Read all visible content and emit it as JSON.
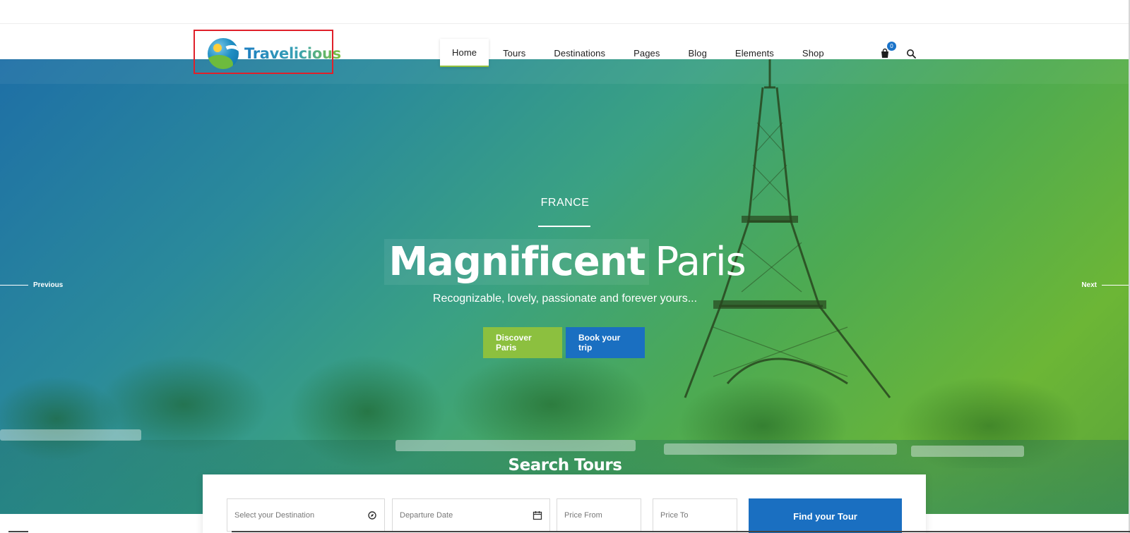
{
  "brand": {
    "name": "Travelicious",
    "colors": {
      "green": "#8cc03f",
      "blue": "#1a6fc1",
      "highlight": "#e0202a"
    }
  },
  "nav": {
    "items": [
      {
        "label": "Home",
        "active": true
      },
      {
        "label": "Tours"
      },
      {
        "label": "Destinations"
      },
      {
        "label": "Pages"
      },
      {
        "label": "Blog"
      },
      {
        "label": "Elements"
      },
      {
        "label": "Shop"
      }
    ],
    "cart_count": "0",
    "cart_icon": "shopping-bag-icon",
    "search_icon": "search-icon"
  },
  "hero": {
    "country": "FRANCE",
    "title_bold": "Magnificent",
    "title_light": "Paris",
    "subtitle": "Recognizable, lovely, passionate and forever yours...",
    "prev_label": "Previous",
    "next_label": "Next",
    "buttons": {
      "discover": "Discover Paris",
      "book": "Book your trip"
    }
  },
  "search_tours": {
    "title": "Search Tours",
    "destination_placeholder": "Select your Destination",
    "departure_placeholder": "Departure Date",
    "price_from_placeholder": "Price From",
    "price_to_placeholder": "Price To",
    "submit_label": "Find your Tour"
  }
}
